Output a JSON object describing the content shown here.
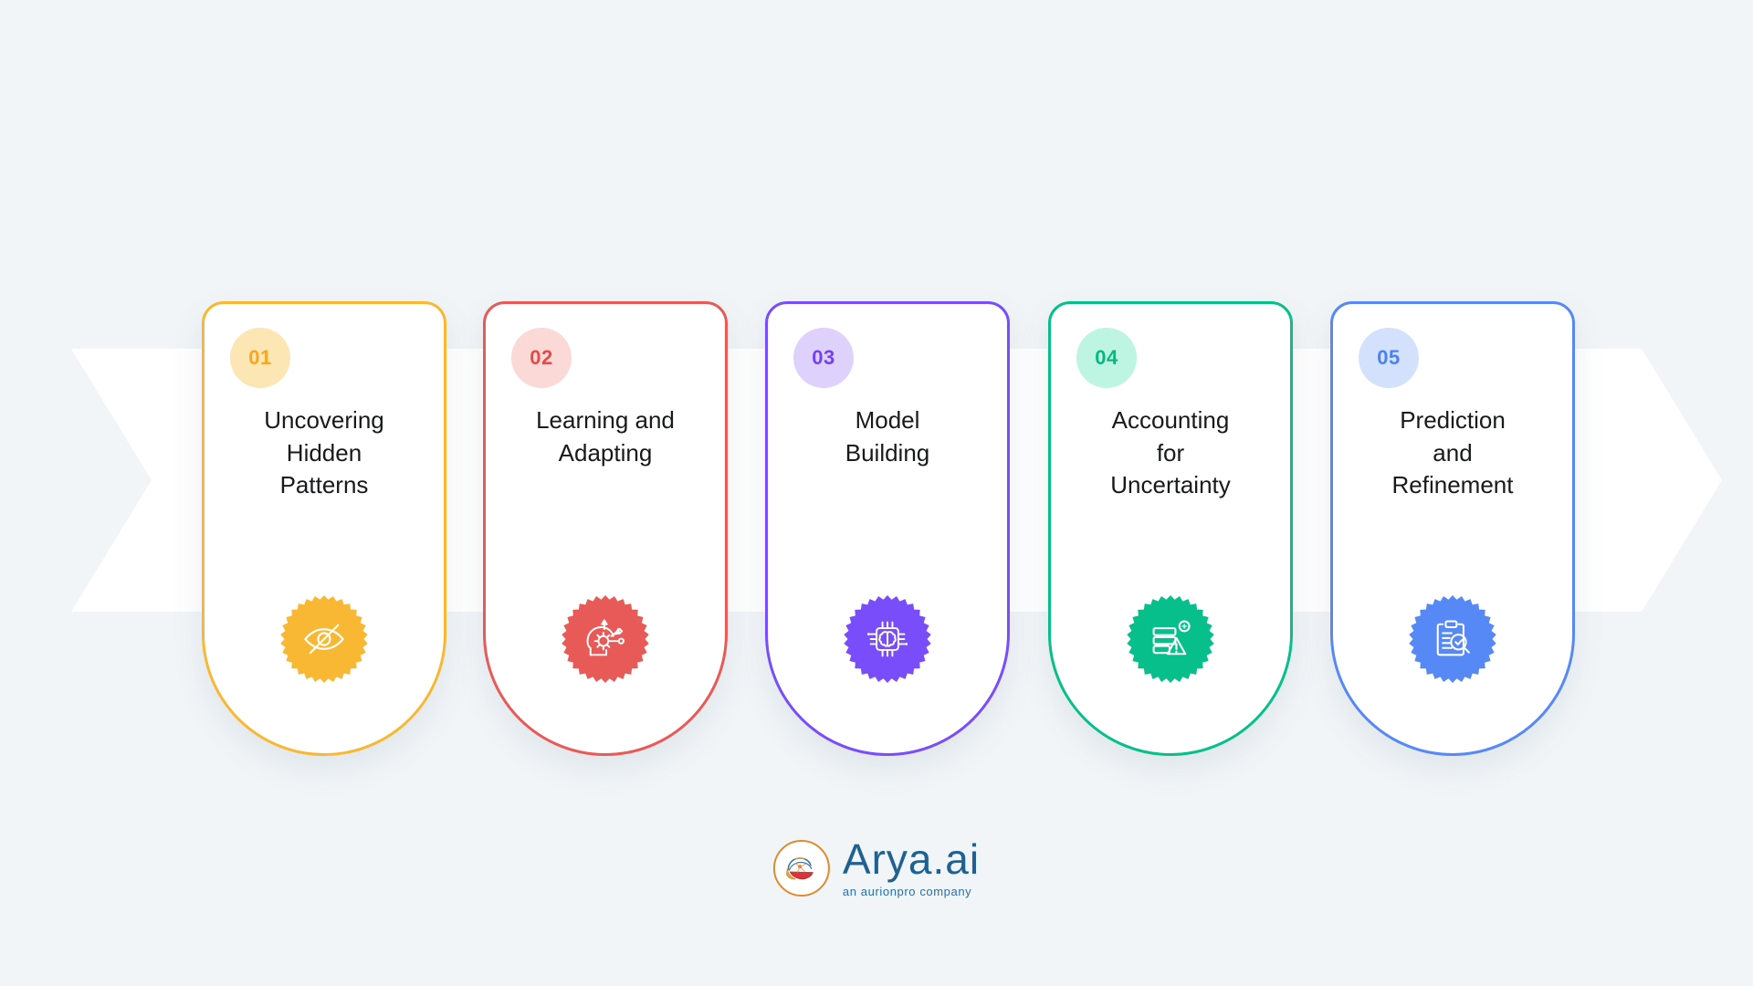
{
  "canvas": {
    "background_color": "#f1f5f8",
    "banner_color": "#ffffff"
  },
  "steps": [
    {
      "number": "01",
      "title": "Uncovering\nHidden\nPatterns",
      "icon": "eye-off-icon",
      "accent_color": "#f8b833",
      "badge_bg_color": "#fbe6b4",
      "badge_text_color": "#f5a623"
    },
    {
      "number": "02",
      "title": "Learning and\nAdapting",
      "icon": "head-gear-adapt-icon",
      "accent_color": "#e85a57",
      "badge_bg_color": "#fbd9d7",
      "badge_text_color": "#e14b49"
    },
    {
      "number": "03",
      "title": "Model\nBuilding",
      "icon": "brain-chip-icon",
      "accent_color": "#7a4dfb",
      "badge_bg_color": "#ded2fc",
      "badge_text_color": "#7340f5"
    },
    {
      "number": "04",
      "title": "Accounting\nfor\nUncertainty",
      "icon": "data-stack-warning-icon",
      "accent_color": "#06bf8a",
      "badge_bg_color": "#bdf5e2",
      "badge_text_color": "#06b981"
    },
    {
      "number": "05",
      "title": "Prediction\nand\nRefinement",
      "icon": "clipboard-check-search-icon",
      "accent_color": "#5689f5",
      "badge_bg_color": "#d4e1fc",
      "badge_text_color": "#4b82f3"
    }
  ],
  "logo": {
    "name": "Arya.ai",
    "tagline": "an aurionpro company",
    "mark": "brain-circle-icon",
    "name_color": "#1f6191",
    "ring_color": "#e08a2e"
  }
}
